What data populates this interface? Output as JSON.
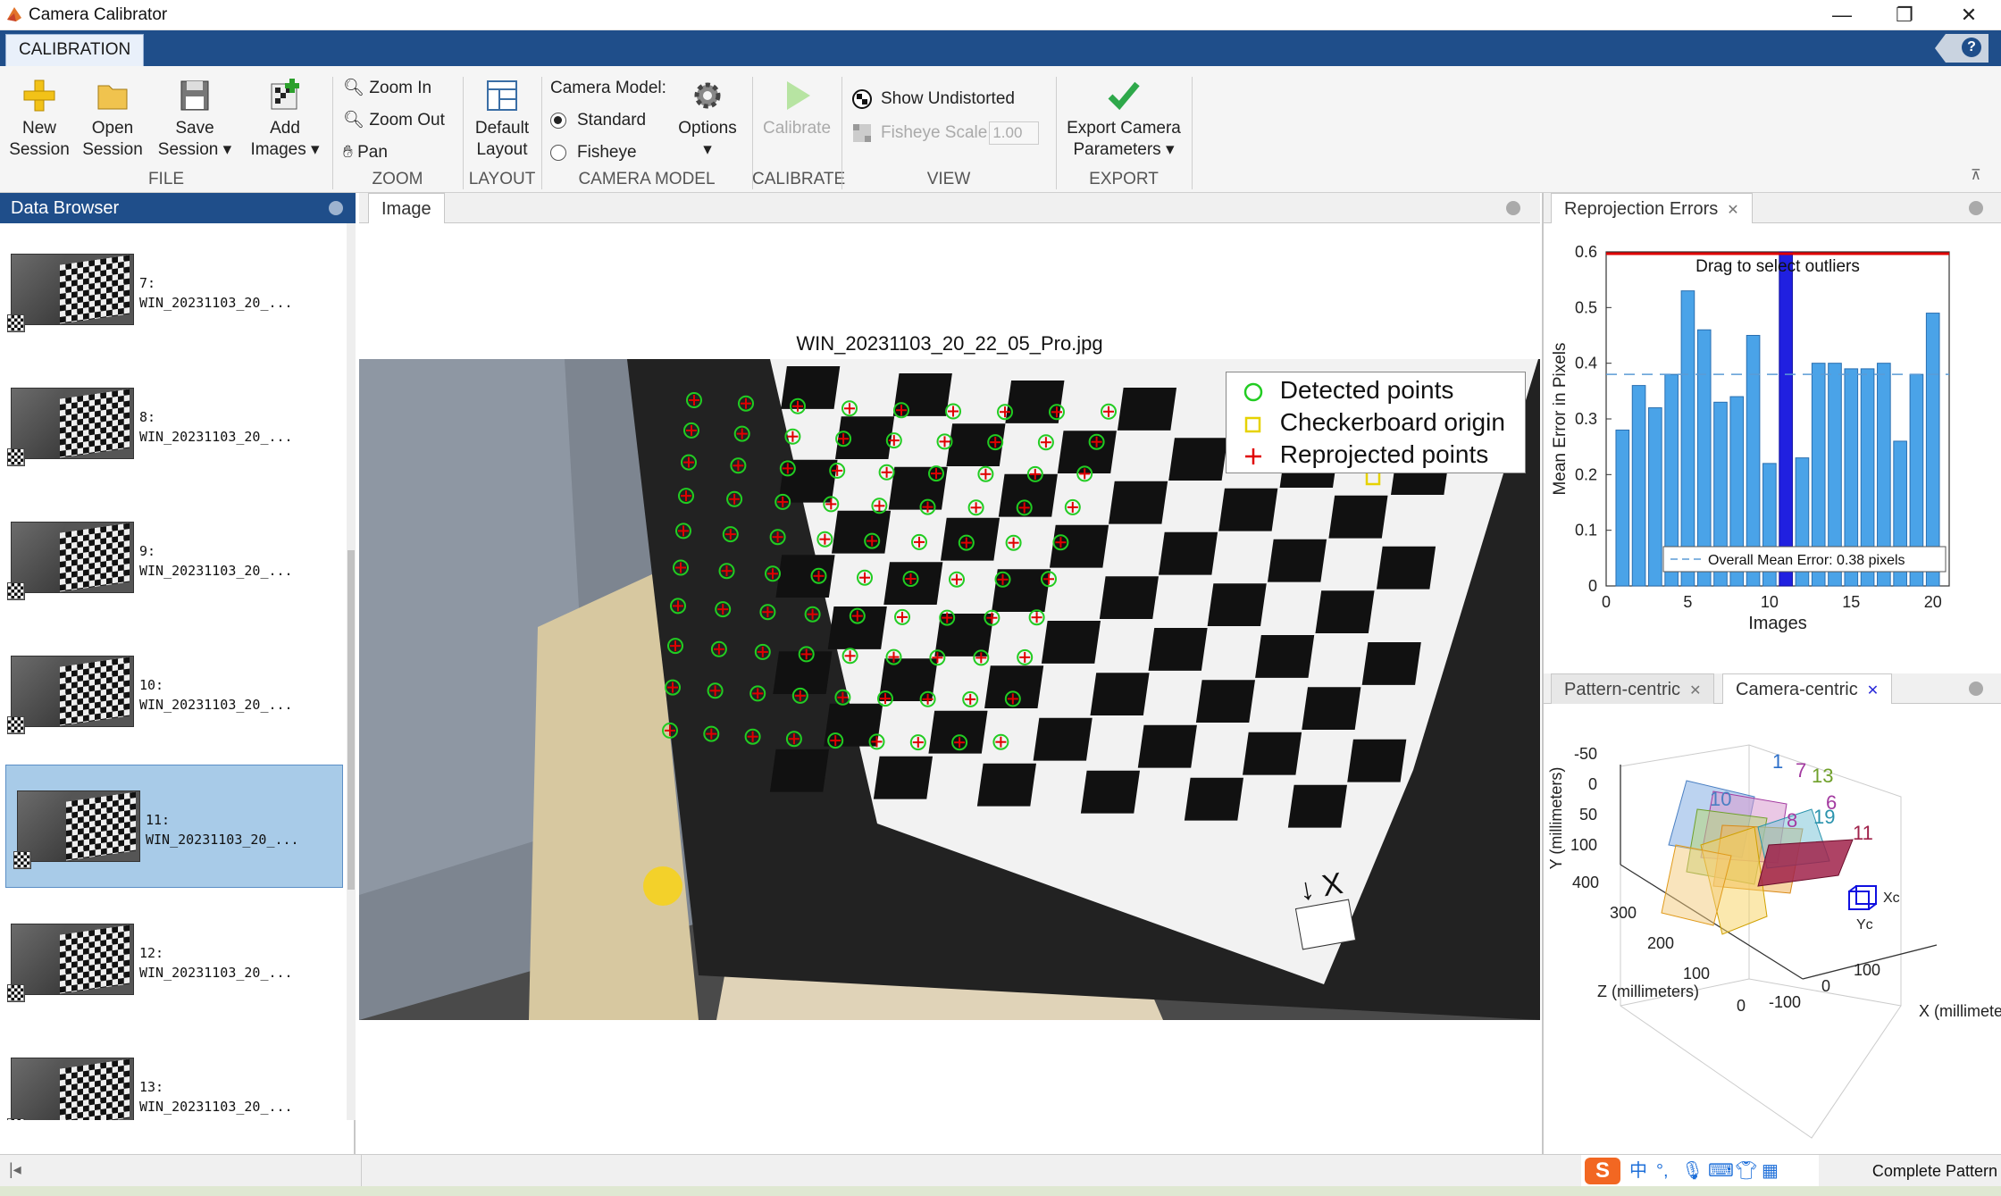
{
  "window": {
    "title": "Camera Calibrator",
    "min": "—",
    "restore": "❐",
    "close": "✕"
  },
  "tabs": {
    "calibration": "CALIBRATION",
    "help": "?"
  },
  "ribbon": {
    "file": {
      "group": "FILE",
      "new_session": [
        "New",
        "Session"
      ],
      "open_session": [
        "Open",
        "Session"
      ],
      "save_session": [
        "Save",
        "Session ▾"
      ],
      "add_images": [
        "Add",
        "Images ▾"
      ]
    },
    "zoom": {
      "group": "ZOOM",
      "zoom_in": "Zoom In",
      "zoom_out": "Zoom Out",
      "pan": "Pan"
    },
    "layout": {
      "group": "LAYOUT",
      "default_layout": [
        "Default",
        "Layout"
      ]
    },
    "camera_model": {
      "group": "CAMERA MODEL",
      "label": "Camera Model:",
      "standard": "Standard",
      "fisheye": "Fisheye",
      "options": "Options",
      "selected": "Standard"
    },
    "calibrate": {
      "group": "CALIBRATE",
      "calibrate": "Calibrate"
    },
    "view": {
      "group": "VIEW",
      "show_undistorted": "Show Undistorted",
      "fisheye_scale": "Fisheye Scale",
      "fisheye_scale_value": "1.00"
    },
    "export": {
      "group": "EXPORT",
      "export": [
        "Export Camera",
        "Parameters ▾"
      ]
    }
  },
  "data_browser": {
    "title": "Data Browser",
    "items": [
      {
        "index": "7:",
        "name": "WIN_20231103_20_..."
      },
      {
        "index": "8:",
        "name": "WIN_20231103_20_..."
      },
      {
        "index": "9:",
        "name": "WIN_20231103_20_..."
      },
      {
        "index": "10:",
        "name": "WIN_20231103_20_..."
      },
      {
        "index": "11:",
        "name": "WIN_20231103_20_..."
      },
      {
        "index": "12:",
        "name": "WIN_20231103_20_..."
      },
      {
        "index": "13:",
        "name": "WIN_20231103_20_..."
      }
    ],
    "selected_index": "11:"
  },
  "image_pane": {
    "tab": "Image",
    "title": "WIN_20231103_20_22_05_Pro.jpg",
    "legend": {
      "detected": "Detected points",
      "origin": "Checkerboard origin",
      "reprojected": "Reprojected points"
    },
    "axis_marker": "↓ X",
    "colors": {
      "detected": "#22cc22",
      "origin": "#e6d200",
      "reprojected": "#e00000"
    }
  },
  "reprojection": {
    "tab": "Reprojection Errors",
    "drag_hint": "Drag to select outliers",
    "mean_label": "Overall Mean Error: 0.38 pixels",
    "chart_data": {
      "type": "bar",
      "categories": [
        1,
        2,
        3,
        4,
        5,
        6,
        7,
        8,
        9,
        10,
        11,
        12,
        13,
        14,
        15,
        16,
        17,
        18,
        19,
        20
      ],
      "values": [
        0.28,
        0.36,
        0.32,
        0.38,
        0.53,
        0.46,
        0.33,
        0.34,
        0.45,
        0.22,
        0.6,
        0.23,
        0.4,
        0.4,
        0.39,
        0.39,
        0.4,
        0.26,
        0.38,
        0.49
      ],
      "highlighted": 11,
      "mean": 0.38,
      "xlabel": "Images",
      "ylabel": "Mean Error in Pixels",
      "xlim": [
        0,
        21
      ],
      "ylim": [
        0,
        0.6
      ],
      "xticks": [
        0,
        5,
        10,
        15,
        20
      ],
      "yticks": [
        0,
        0.1,
        0.2,
        0.3,
        0.4,
        0.5,
        0.6
      ],
      "bar_color": "#4aa3e8",
      "highlight_color": "#2020e0",
      "threshold_color": "#e00000"
    }
  },
  "extrinsics": {
    "tabs": [
      "Pattern-centric",
      "Camera-centric"
    ],
    "active": "Camera-centric",
    "ylabel": "Y (millimeters)",
    "zlabel": "Z (millimeters)",
    "xlabel": "X (millimeters)",
    "yticks": [
      "-50",
      "0",
      "50",
      "100"
    ],
    "zticks": [
      "400",
      "300",
      "200",
      "100",
      "0"
    ],
    "xticks": [
      "-100",
      "0",
      "100"
    ],
    "labels": [
      "13",
      "10",
      "19",
      "6",
      "11",
      "1",
      "7",
      "8"
    ],
    "cam_x": "Xc",
    "cam_y": "Yc"
  },
  "status": {
    "text": "Complete Pattern"
  }
}
